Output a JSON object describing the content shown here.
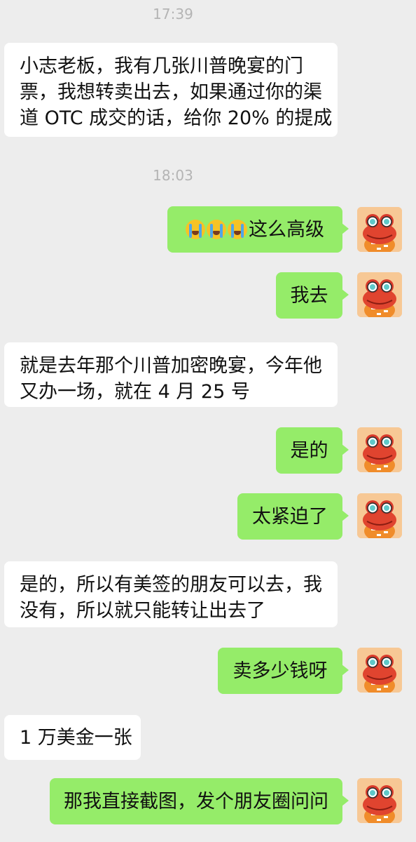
{
  "timestamps": [
    "17:39",
    "18:03"
  ],
  "messages": [
    {
      "side": "in",
      "lines": [
        "小志老板，我有几张川普晚宴的门",
        "票，我想转卖出去，如果通过你的渠",
        "道 OTC 成交的话，给你 20% 的提成"
      ]
    },
    {
      "side": "out",
      "emoji_name": "loudly-crying-emoji",
      "emoji_count": 3,
      "text": "这么高级"
    },
    {
      "side": "out",
      "text": "我去"
    },
    {
      "side": "in",
      "lines": [
        "就是去年那个川普加密晚宴，今年他",
        "又办一场，就在 4 月 25 号"
      ]
    },
    {
      "side": "out",
      "text": "是的"
    },
    {
      "side": "out",
      "text": "太紧迫了"
    },
    {
      "side": "in",
      "lines": [
        "是的，所以有美签的朋友可以去，我",
        "没有，所以就只能转让出去了"
      ]
    },
    {
      "side": "out",
      "text": "卖多少钱呀"
    },
    {
      "side": "in",
      "lines": [
        "1 万美金一张"
      ]
    },
    {
      "side": "out",
      "text": "那我直接截图，发个朋友圈问问"
    }
  ],
  "avatar_icon": "red-frog-avatar-icon",
  "colors": {
    "background": "#ededed",
    "incoming_bubble": "#ffffff",
    "outgoing_bubble": "#95ec69",
    "timestamp_text": "#b4b4b4",
    "message_text": "#111111"
  }
}
